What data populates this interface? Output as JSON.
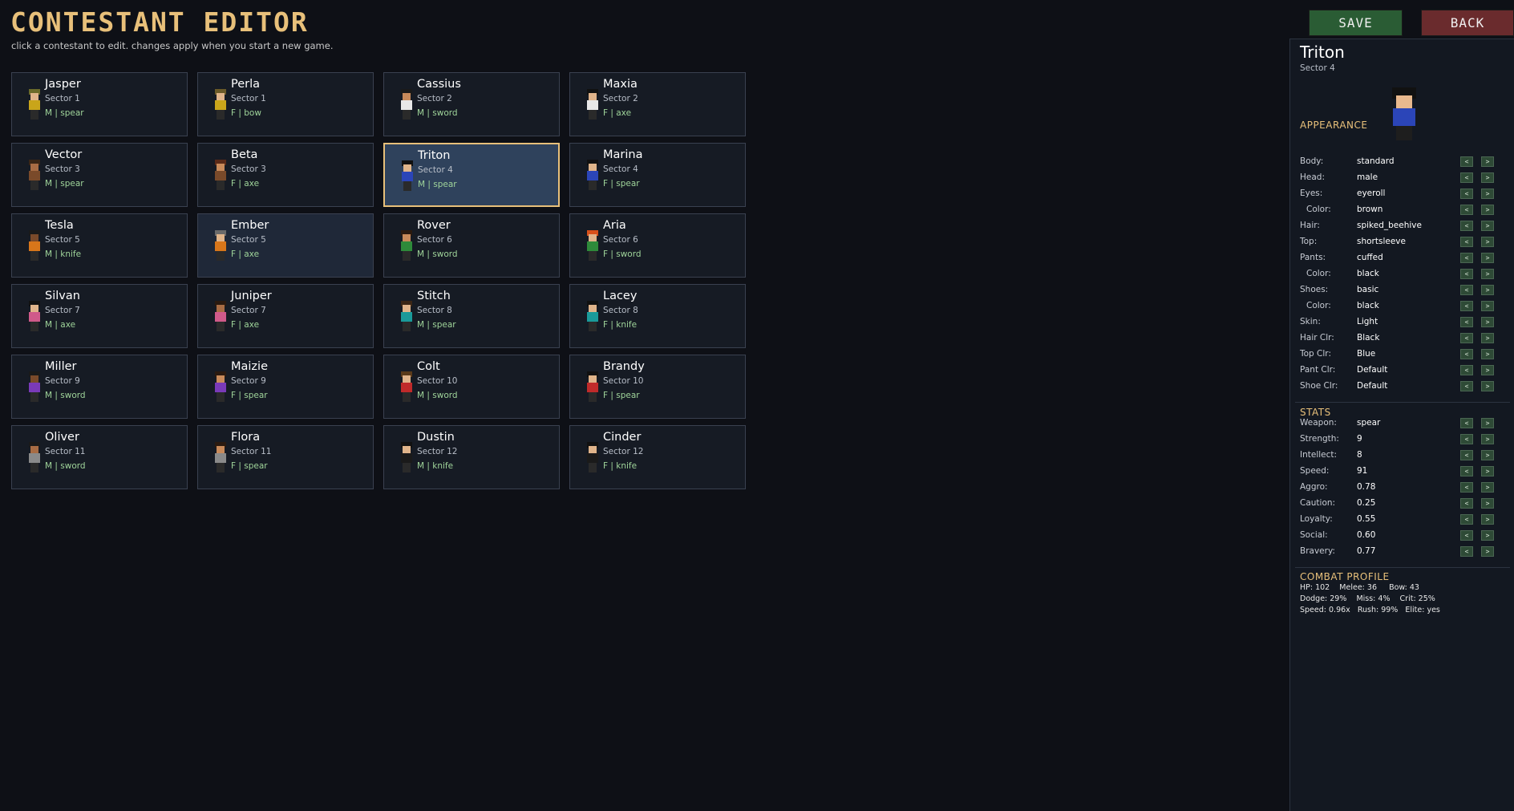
{
  "header": {
    "title": "CONTESTANT EDITOR",
    "subtitle": "click a contestant to edit. changes apply when you start a new game."
  },
  "buttons": {
    "save": "SAVE",
    "back": "BACK"
  },
  "contestants": [
    {
      "name": "Jasper",
      "sector": "Sector 1",
      "info": "M | spear",
      "hair": "#6b6a2a",
      "skin": "#e0b48a",
      "top": "#c9a51a"
    },
    {
      "name": "Perla",
      "sector": "Sector 1",
      "info": "F | bow",
      "hair": "#6b5a28",
      "skin": "#e0b48a",
      "top": "#c9a51a"
    },
    {
      "name": "Cassius",
      "sector": "Sector 2",
      "info": "M | sword",
      "hair": "#1a1a1a",
      "skin": "#c88a5a",
      "top": "#e8e8e8"
    },
    {
      "name": "Maxia",
      "sector": "Sector 2",
      "info": "F | axe",
      "hair": "#111111",
      "skin": "#e0b48a",
      "top": "#e8e8e8"
    },
    {
      "name": "Vector",
      "sector": "Sector 3",
      "info": "M | spear",
      "hair": "#3a2616",
      "skin": "#a86c44",
      "top": "#7a4a2a"
    },
    {
      "name": "Beta",
      "sector": "Sector 3",
      "info": "F | axe",
      "hair": "#5a2a18",
      "skin": "#c88a5a",
      "top": "#7a4a2a"
    },
    {
      "name": "Triton",
      "sector": "Sector 4",
      "info": "M | spear",
      "hair": "#111111",
      "skin": "#e0b48a",
      "top": "#2b45b8"
    },
    {
      "name": "Marina",
      "sector": "Sector 4",
      "info": "F | spear",
      "hair": "#111111",
      "skin": "#e0b48a",
      "top": "#2b45b8"
    },
    {
      "name": "Tesla",
      "sector": "Sector 5",
      "info": "M | knife",
      "hair": "#1a1a1a",
      "skin": "#7a4a2a",
      "top": "#d8761a"
    },
    {
      "name": "Ember",
      "sector": "Sector 5",
      "info": "F | axe",
      "hair": "#6a6a6a",
      "skin": "#e0b48a",
      "top": "#d8761a"
    },
    {
      "name": "Rover",
      "sector": "Sector 6",
      "info": "M | sword",
      "hair": "#2a1a10",
      "skin": "#c88a5a",
      "top": "#2e8a3a"
    },
    {
      "name": "Aria",
      "sector": "Sector 6",
      "info": "F | sword",
      "hair": "#d8501a",
      "skin": "#e0b48a",
      "top": "#2e8a3a"
    },
    {
      "name": "Silvan",
      "sector": "Sector 7",
      "info": "M | axe",
      "hair": "#111111",
      "skin": "#e0b48a",
      "top": "#d05a8a"
    },
    {
      "name": "Juniper",
      "sector": "Sector 7",
      "info": "F | axe",
      "hair": "#2a1a10",
      "skin": "#a86c44",
      "top": "#d05a8a"
    },
    {
      "name": "Stitch",
      "sector": "Sector 8",
      "info": "M | spear",
      "hair": "#3a2616",
      "skin": "#e0b48a",
      "top": "#1a9a9a"
    },
    {
      "name": "Lacey",
      "sector": "Sector 8",
      "info": "F | knife",
      "hair": "#111111",
      "skin": "#e0b48a",
      "top": "#1a9a9a"
    },
    {
      "name": "Miller",
      "sector": "Sector 9",
      "info": "M | sword",
      "hair": "#1a1a1a",
      "skin": "#7a4a2a",
      "top": "#7a3ab8"
    },
    {
      "name": "Maizie",
      "sector": "Sector 9",
      "info": "F | spear",
      "hair": "#2a1a10",
      "skin": "#c88a5a",
      "top": "#7a3ab8"
    },
    {
      "name": "Colt",
      "sector": "Sector 10",
      "info": "M | sword",
      "hair": "#5a3a1a",
      "skin": "#e0b48a",
      "top": "#c02a2a"
    },
    {
      "name": "Brandy",
      "sector": "Sector 10",
      "info": "F | spear",
      "hair": "#111111",
      "skin": "#e0b48a",
      "top": "#c02a2a"
    },
    {
      "name": "Oliver",
      "sector": "Sector 11",
      "info": "M | sword",
      "hair": "#1a1a1a",
      "skin": "#a86c44",
      "top": "#8a8a8a"
    },
    {
      "name": "Flora",
      "sector": "Sector 11",
      "info": "F | spear",
      "hair": "#2a1a10",
      "skin": "#c88a5a",
      "top": "#8a8a8a"
    },
    {
      "name": "Dustin",
      "sector": "Sector 12",
      "info": "M | knife",
      "hair": "#111111",
      "skin": "#e0b48a",
      "top": "#1a1a1a"
    },
    {
      "name": "Cinder",
      "sector": "Sector 12",
      "info": "F | knife",
      "hair": "#111111",
      "skin": "#e0b48a",
      "top": "#1a1a1a"
    }
  ],
  "selected_index": 6,
  "hover_index": 9,
  "detail": {
    "name": "Triton",
    "sector": "Sector 4",
    "appearance_title": "APPEARANCE",
    "appearance": [
      {
        "label": "Body:",
        "value": "standard",
        "indent": false
      },
      {
        "label": "Head:",
        "value": "male",
        "indent": false
      },
      {
        "label": "Eyes:",
        "value": "eyeroll",
        "indent": false
      },
      {
        "label": "Color:",
        "value": "brown",
        "indent": true
      },
      {
        "label": "Hair:",
        "value": "spiked_beehive",
        "indent": false
      },
      {
        "label": "Top:",
        "value": "shortsleeve",
        "indent": false
      },
      {
        "label": "Pants:",
        "value": "cuffed",
        "indent": false
      },
      {
        "label": "Color:",
        "value": "black",
        "indent": true
      },
      {
        "label": "Shoes:",
        "value": "basic",
        "indent": false
      },
      {
        "label": "Color:",
        "value": "black",
        "indent": true
      },
      {
        "label": "Skin:",
        "value": "Light",
        "indent": false
      },
      {
        "label": "Hair Clr:",
        "value": "Black",
        "indent": false
      },
      {
        "label": "Top Clr:",
        "value": "Blue",
        "indent": false
      },
      {
        "label": "Pant Clr:",
        "value": "Default",
        "indent": false
      },
      {
        "label": "Shoe Clr:",
        "value": "Default",
        "indent": false
      }
    ],
    "stats_title": "STATS",
    "stats": [
      {
        "label": "Weapon:",
        "value": "spear"
      },
      {
        "label": "Strength:",
        "value": "9"
      },
      {
        "label": "Intellect:",
        "value": "8"
      },
      {
        "label": "Speed:",
        "value": "91"
      },
      {
        "label": "Aggro:",
        "value": "0.78"
      },
      {
        "label": "Caution:",
        "value": "0.25"
      },
      {
        "label": "Loyalty:",
        "value": "0.55"
      },
      {
        "label": "Social:",
        "value": "0.60"
      },
      {
        "label": "Bravery:",
        "value": "0.77"
      }
    ],
    "arrow_left": "<",
    "arrow_right": ">",
    "combat_title": "COMBAT PROFILE",
    "combat_lines": [
      "HP: 102    Melee: 36     Bow: 43",
      "Dodge: 29%    Miss: 4%    Crit: 25%",
      "Speed: 0.96x   Rush: 99%   Elite: yes"
    ]
  }
}
